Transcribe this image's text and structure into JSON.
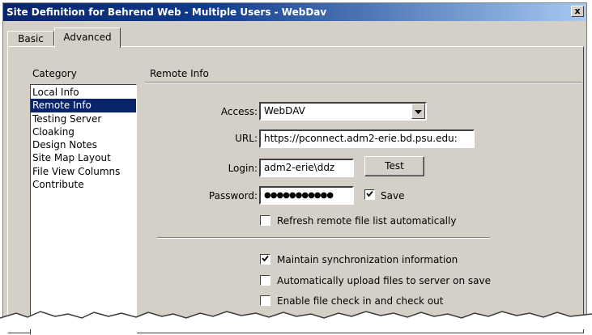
{
  "window": {
    "title": "Site Definition for Behrend Web - Multiple Users - WebDav",
    "close_glyph": "x"
  },
  "tabs": [
    {
      "label": "Basic",
      "active": false
    },
    {
      "label": "Advanced",
      "active": true
    }
  ],
  "category": {
    "heading": "Category",
    "items": [
      {
        "label": "Local Info",
        "selected": false
      },
      {
        "label": "Remote Info",
        "selected": true
      },
      {
        "label": "Testing Server",
        "selected": false
      },
      {
        "label": "Cloaking",
        "selected": false
      },
      {
        "label": "Design Notes",
        "selected": false
      },
      {
        "label": "Site Map Layout",
        "selected": false
      },
      {
        "label": "File View Columns",
        "selected": false
      },
      {
        "label": "Contribute",
        "selected": false
      }
    ]
  },
  "remote": {
    "heading": "Remote Info",
    "access_label": "Access:",
    "access_value": "WebDAV",
    "url_label": "URL:",
    "url_value": "https://pconnect.adm2-erie.bd.psu.edu:",
    "login_label": "Login:",
    "login_value": "adm2-erie\\ddz",
    "test_label": "Test",
    "password_label": "Password:",
    "password_value": "●●●●●●●●●●●",
    "save_label": "Save",
    "save_checked": true,
    "refresh_label": "Refresh remote file list automatically",
    "refresh_checked": false,
    "maintain_label": "Maintain synchronization information",
    "maintain_checked": true,
    "upload_label": "Automatically upload files to server on save",
    "upload_checked": false,
    "checkin_label": "Enable file check in and check out",
    "checkin_checked": false
  },
  "icons": {
    "dropdown": "chevron-down-icon",
    "check": "checkmark-icon"
  },
  "colors": {
    "titlebar": "#0a246a",
    "dialog": "#d4d0c8",
    "selection": "#0a246a"
  }
}
